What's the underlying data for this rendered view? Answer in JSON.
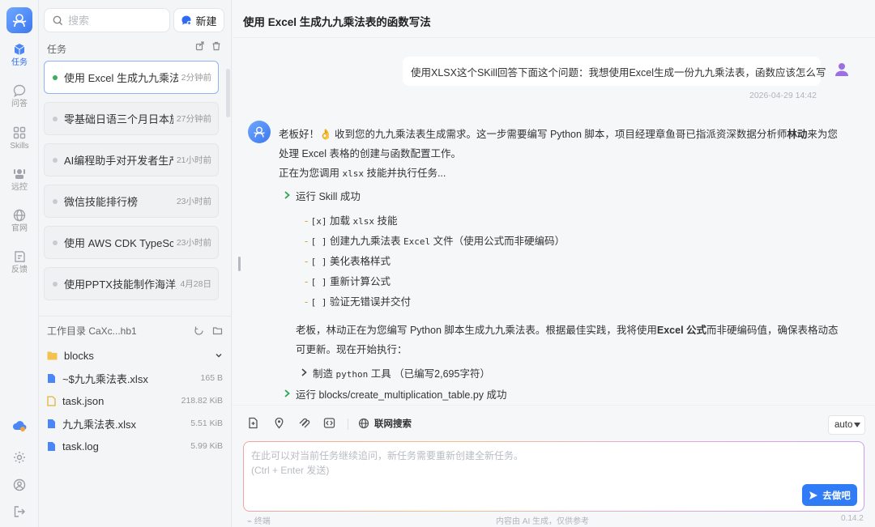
{
  "rail": {
    "items": [
      {
        "label": "任务",
        "icon": "tasks-cube-icon",
        "active": true
      },
      {
        "label": "问答",
        "icon": "chat-bubble-icon"
      },
      {
        "label": "Skills",
        "icon": "skills-grid-icon"
      },
      {
        "label": "远控",
        "icon": "remote-control-icon"
      },
      {
        "label": "官网",
        "icon": "globe-icon"
      },
      {
        "label": "反馈",
        "icon": "feedback-icon"
      }
    ]
  },
  "sidebar": {
    "search_placeholder": "搜索",
    "new_label": "新建",
    "section_title": "任务",
    "tasks": [
      {
        "name": "使用 Excel 生成九九乘法表的函数写法",
        "time": "2分钟前",
        "active": true
      },
      {
        "name": "零基础日语三个月日本旅行学习计划",
        "time": "27分钟前"
      },
      {
        "name": "AI编程助手对开发者生产力的影响",
        "time": "21小时前"
      },
      {
        "name": "微信技能排行榜",
        "time": "23小时前"
      },
      {
        "name": "使用 AWS CDK TypeScript 部署应用",
        "time": "23小时前"
      },
      {
        "name": "使用PPTX技能制作海洋主题演示文稿",
        "time": "4月28日"
      }
    ],
    "workdir": {
      "title": "工作目录 CaXc...hb1",
      "files": [
        {
          "name": "blocks",
          "size": "",
          "type": "folder"
        },
        {
          "name": "~$九九乘法表.xlsx",
          "size": "165 B",
          "type": "file"
        },
        {
          "name": "task.json",
          "size": "218.82 KiB",
          "type": "json"
        },
        {
          "name": "九九乘法表.xlsx",
          "size": "5.51 KiB",
          "type": "file"
        },
        {
          "name": "task.log",
          "size": "5.99 KiB",
          "type": "file"
        }
      ]
    }
  },
  "main": {
    "title": "使用 Excel 生成九九乘法表的函数写法",
    "user_message": "使用XLSX这个SKill回答下面这个问题：我想使用Excel生成一份九九乘法表，函数应该怎么写",
    "user_time": "2026-04-29 14:42",
    "bot": {
      "line1_a": "老板好！👌 收到您的九九乘法表生成需求。这一步需要编写 Python 脚本，项目经理章鱼哥已指派资深数据分析师",
      "line1_bold": "林动",
      "line1_b": "来为您",
      "line2": "处理 Excel 表格的创建与函数配置工作。",
      "line3_a": "正在为您调用 ",
      "line3_code": "xlsx",
      "line3_b": " 技能并执行任务...",
      "skill_run": "运行 Skill 成功",
      "todos": [
        {
          "box": "[x]",
          "text": "加载 ",
          "code": "xlsx",
          "tail": " 技能"
        },
        {
          "box": "[ ]",
          "text": "创建九九乘法表 ",
          "code": "Excel",
          "tail": " 文件（使用公式而非硬编码）"
        },
        {
          "box": "[ ]",
          "text": "美化表格样式",
          "code": "",
          "tail": ""
        },
        {
          "box": "[ ]",
          "text": "重新计算公式",
          "code": "",
          "tail": ""
        },
        {
          "box": "[ ]",
          "text": "验证无错误并交付",
          "code": "",
          "tail": ""
        }
      ],
      "para_a": "老板，林动正在为您编写 Python 脚本生成九九乘法表。根据最佳实践，我将使用",
      "para_bold": "Excel 公式",
      "para_b": "而非硬编码值，确保表格动态",
      "para_2": "可更新。现在开始执行：",
      "tool_label": "制造 ",
      "tool_code": "python",
      "tool_tail": " 工具  （已编写2,695字符）",
      "run_script": "运行 blocks/create_multiplication_table.py 成功"
    }
  },
  "composer": {
    "net_search": "联网搜索",
    "mode": "auto",
    "placeholder": "在此可以对当前任务继续追问，新任务需要重新创建全新任务。\n(Ctrl + Enter 发送)",
    "send_label": "去做吧",
    "footer_left": "终端",
    "footer_center": "内容由 AI 生成，仅供参考",
    "version": "0.14.2"
  },
  "colors": {
    "accent": "#2f7cf6",
    "active_dot": "#34b25a",
    "check": "#2da44e"
  }
}
